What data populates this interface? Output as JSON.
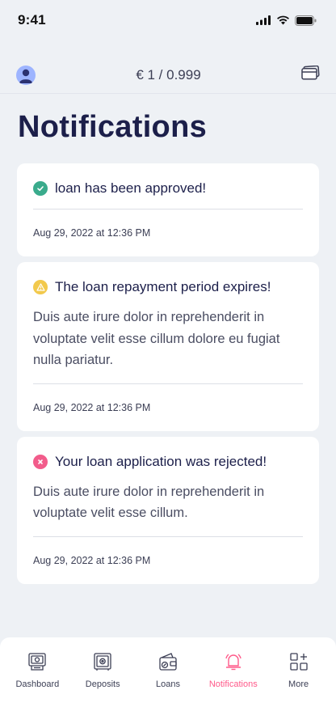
{
  "status_bar": {
    "time": "9:41"
  },
  "header": {
    "rate": "€ 1 / 0.999"
  },
  "page": {
    "title": "Notifications"
  },
  "notifications": [
    {
      "status": "success",
      "status_color": "#3aab8c",
      "title": "loan has been approved!",
      "body": "",
      "date": "Aug 29, 2022 at 12:36 PM"
    },
    {
      "status": "warning",
      "status_color": "#f2c94c",
      "title": "The loan repayment period expires!",
      "body": "Duis aute irure dolor in reprehenderit in voluptate velit esse cillum dolore eu fugiat nulla pariatur.",
      "date": "Aug 29, 2022 at 12:36 PM"
    },
    {
      "status": "error",
      "status_color": "#f25c8b",
      "title": "Your loan application was rejected!",
      "body": "Duis aute irure dolor in reprehenderit in voluptate velit esse cillum.",
      "date": "Aug 29, 2022 at 12:36 PM"
    }
  ],
  "tabs": [
    {
      "label": "Dashboard",
      "icon": "dashboard-icon"
    },
    {
      "label": "Deposits",
      "icon": "safe-icon"
    },
    {
      "label": "Loans",
      "icon": "wallet-icon"
    },
    {
      "label": "Notifications",
      "icon": "bell-icon",
      "active": true
    },
    {
      "label": "More",
      "icon": "grid-plus-icon"
    }
  ],
  "colors": {
    "accent": "#ff5a8a",
    "title": "#1c1f4a",
    "background": "#eef1f5"
  }
}
